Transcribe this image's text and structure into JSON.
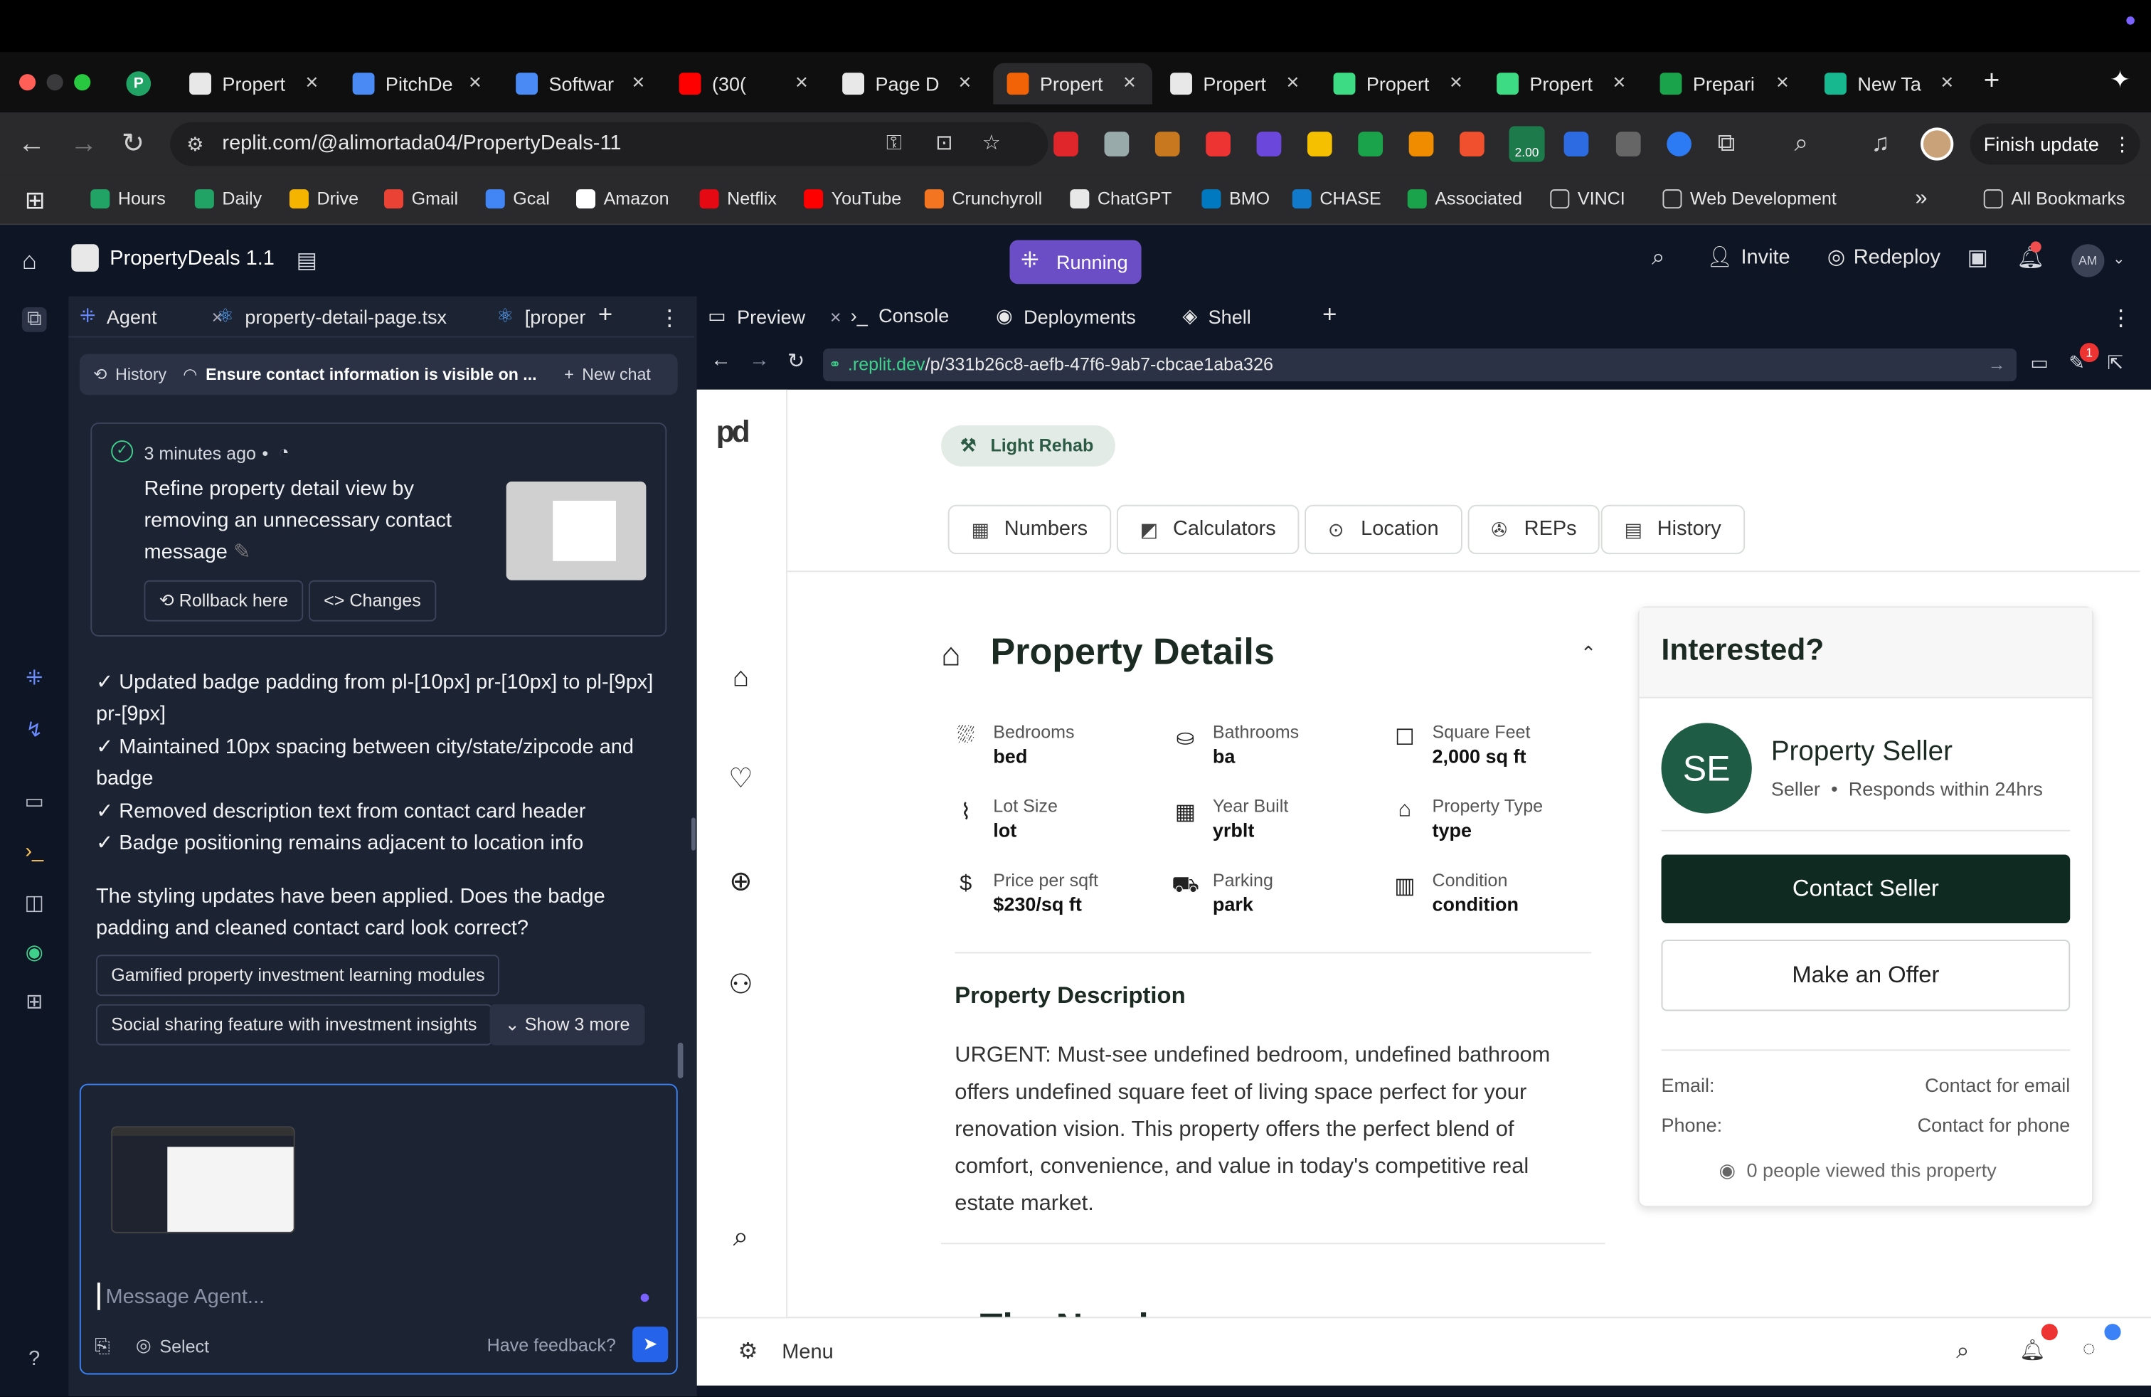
{
  "browser": {
    "tabs": [
      {
        "label": "Propert",
        "color": "#e8e8e8"
      },
      {
        "label": "PitchDe",
        "color": "#4a8af4"
      },
      {
        "label": "Softwar",
        "color": "#4a8af4"
      },
      {
        "label": "(30(",
        "color": "#ff0000"
      },
      {
        "label": "Page D",
        "color": "#e8e8e8"
      },
      {
        "label": "Propert",
        "color": "#f26207"
      },
      {
        "label": "Propert",
        "color": "#e8e8e8"
      },
      {
        "label": "Propert",
        "color": "#3ddc84"
      },
      {
        "label": "Propert",
        "color": "#3ddc84"
      },
      {
        "label": "Prepari",
        "color": "#1aa34a"
      },
      {
        "label": "New Ta",
        "color": "#17b890"
      }
    ],
    "url": "replit.com/@alimortada04/PropertyDeals-11",
    "finish_update": "Finish update",
    "ext_badge": "2.00",
    "bookmarks": [
      "Hours",
      "Daily",
      "Drive",
      "Gmail",
      "Gcal",
      "Amazon",
      "Netflix",
      "YouTube",
      "Crunchyroll",
      "ChatGPT",
      "BMO",
      "CHASE",
      "Associated",
      "VINCI",
      "Web Development"
    ],
    "bookmarks_more": "»",
    "all_bookmarks": "All Bookmarks"
  },
  "replit": {
    "project": "PropertyDeals 1.1",
    "status": "Running",
    "invite": "Invite",
    "redeploy": "Redeploy",
    "avatar": "AM"
  },
  "agent": {
    "tabs": [
      "Agent",
      "property-detail-page.tsx",
      "[proper"
    ],
    "history": "History",
    "chat_title": "Ensure contact information is visible on ...",
    "new_chat": "New chat",
    "checkpoint": {
      "time": "3 minutes ago",
      "text_lines": [
        "Refine property detail view by",
        "removing an unnecessary contact",
        "message"
      ],
      "rollback": "Rollback here",
      "changes": "Changes"
    },
    "updates": [
      "✓ Updated badge padding from pl-[10px] pr-[10px] to pl-[9px]",
      "pr-[9px]",
      "✓ Maintained 10px spacing between city/state/zipcode and",
      "badge",
      "✓ Removed description text from contact card header",
      "✓ Badge positioning remains adjacent to location info"
    ],
    "question_lines": [
      "The styling updates have been applied. Does the badge",
      "padding and cleaned contact card look correct?"
    ],
    "suggestions": [
      "Gamified property investment learning modules",
      "Social sharing feature with investment insights"
    ],
    "show_more": "Show 3 more",
    "composer_placeholder": "Message Agent...",
    "select": "Select",
    "feedback": "Have feedback?"
  },
  "preview": {
    "tabs": [
      "Preview",
      "Console",
      "Deployments",
      "Shell"
    ],
    "url": ".replit.dev/p/331b26c8-aefb-47f6-9ab7-cbcae1aba326",
    "notif_count": "1"
  },
  "app": {
    "logo": "pd",
    "badge": "Light Rehab",
    "detail_tabs": [
      "Numbers",
      "Calculators",
      "Location",
      "REPs",
      "History"
    ],
    "section_title": "Property Details",
    "details": [
      {
        "label": "Bedrooms",
        "value": "bed"
      },
      {
        "label": "Bathrooms",
        "value": "ba"
      },
      {
        "label": "Square Feet",
        "value": "2,000 sq ft"
      },
      {
        "label": "Lot Size",
        "value": "lot"
      },
      {
        "label": "Year Built",
        "value": "yrblt"
      },
      {
        "label": "Property Type",
        "value": "type"
      },
      {
        "label": "Price per sqft",
        "value": "$230/sq ft"
      },
      {
        "label": "Parking",
        "value": "park"
      },
      {
        "label": "Condition",
        "value": "condition"
      }
    ],
    "description_title": "Property Description",
    "description_lines": [
      "URGENT: Must-see undefined bedroom, undefined bathroom",
      "offers undefined square feet of living space perfect for your",
      "renovation vision. This property offers the perfect blend of",
      "comfort, convenience, and value in today's competitive real",
      "estate market."
    ],
    "next_section_partial": "The Numb",
    "interested": {
      "title": "Interested?",
      "initials": "SE",
      "seller_name": "Property Seller",
      "seller_role": "Seller",
      "responds": "Responds within 24hrs",
      "contact_seller": "Contact Seller",
      "make_offer": "Make an Offer",
      "email_label": "Email:",
      "email_value": "Contact for email",
      "phone_label": "Phone:",
      "phone_value": "Contact for phone",
      "views": "0 people viewed this property"
    },
    "menu": "Menu"
  }
}
